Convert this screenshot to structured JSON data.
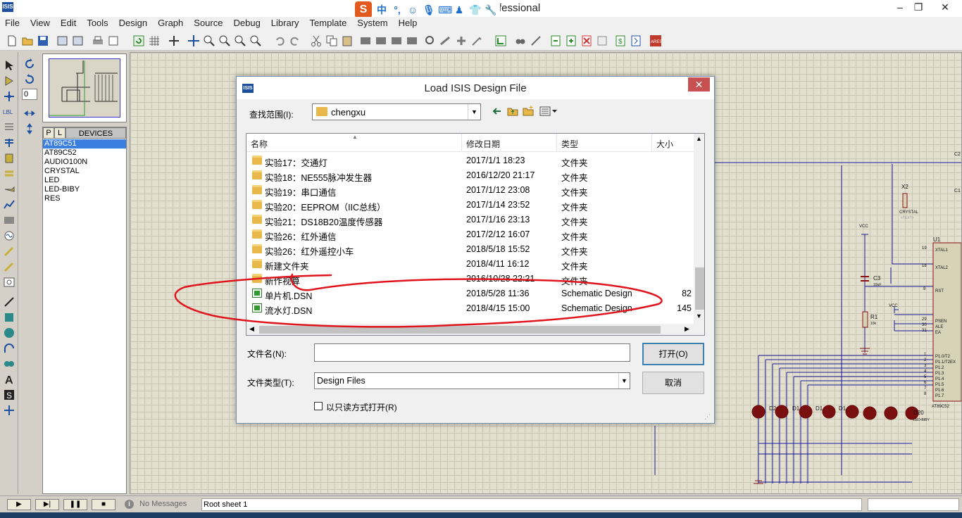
{
  "app": {
    "logo_text": "ISIS",
    "title": "fessional",
    "window_controls": {
      "minimize": "–",
      "maximize": "❐",
      "close": "✕"
    }
  },
  "ime": {
    "logo": "S",
    "items": [
      "中",
      "°,",
      "☺",
      "🎙",
      "⌨",
      "♟",
      "👕",
      "🔧"
    ]
  },
  "menu": [
    "File",
    "View",
    "Edit",
    "Tools",
    "Design",
    "Graph",
    "Source",
    "Debug",
    "Library",
    "Template",
    "System",
    "Help"
  ],
  "devices": {
    "tabs": [
      "P",
      "L"
    ],
    "title": "DEVICES",
    "items": [
      "AT89C51",
      "AT89C52",
      "AUDIO100N",
      "CRYSTAL",
      "LED",
      "LED-BIBY",
      "RES"
    ],
    "selected": "AT89C51"
  },
  "rotation": {
    "value": "0"
  },
  "statusbar": {
    "sim_buttons": [
      "▶",
      "▶|",
      "❚❚",
      "■"
    ],
    "message_icon": "i",
    "messages": "No Messages",
    "sheet": "Root sheet 1"
  },
  "dialog": {
    "logo_text": "ISIS",
    "title": "Load ISIS Design File",
    "close": "✕",
    "look_in_label": "查找范围(I):",
    "look_in_value": "chengxu",
    "columns": [
      "名称",
      "修改日期",
      "类型",
      "大小"
    ],
    "files": [
      {
        "name": "实验17：交通灯",
        "date": "2017/1/1 18:23",
        "type": "文件夹",
        "size": "",
        "kind": "folder"
      },
      {
        "name": "实验18：NE555脉冲发生器",
        "date": "2016/12/20 21:17",
        "type": "文件夹",
        "size": "",
        "kind": "folder"
      },
      {
        "name": "实验19：串口通信",
        "date": "2017/1/12 23:08",
        "type": "文件夹",
        "size": "",
        "kind": "folder"
      },
      {
        "name": "实验20：EEPROM（IIC总线）",
        "date": "2017/1/14 23:52",
        "type": "文件夹",
        "size": "",
        "kind": "folder"
      },
      {
        "name": "实验21：DS18B20温度传感器",
        "date": "2017/1/16 23:13",
        "type": "文件夹",
        "size": "",
        "kind": "folder"
      },
      {
        "name": "实验26：红外通信",
        "date": "2017/2/12 16:07",
        "type": "文件夹",
        "size": "",
        "kind": "folder"
      },
      {
        "name": "实验26：红外遥控小车",
        "date": "2018/5/18 15:52",
        "type": "文件夹",
        "size": "",
        "kind": "folder"
      },
      {
        "name": "新建文件夹",
        "date": "2018/4/11 16:12",
        "type": "文件夹",
        "size": "",
        "kind": "folder"
      },
      {
        "name": "新作视算",
        "date": "2016/10/28 22:21",
        "type": "文件夹",
        "size": "",
        "kind": "folder"
      },
      {
        "name": "单片机.DSN",
        "date": "2018/5/28 11:36",
        "type": "Schematic Design",
        "size": "82",
        "kind": "dsn"
      },
      {
        "name": "流水灯.DSN",
        "date": "2018/4/15 15:00",
        "type": "Schematic Design",
        "size": "145",
        "kind": "dsn"
      }
    ],
    "filename_label": "文件名(N):",
    "filename_value": "",
    "filetype_label": "文件类型(T):",
    "filetype_value": "Design Files",
    "open_label": "打开(O)",
    "cancel_label": "取消",
    "readonly_label": "以只读方式打开(R)"
  },
  "schematic": {
    "labels": [
      "C2",
      "C1",
      "X2",
      "CRYSTAL",
      "<TEXT>",
      "VCC",
      "U1",
      "XTAL1",
      "XTAL2",
      "RST",
      "C3",
      "10uF",
      "R1",
      "10k",
      "VCC",
      "PSEN",
      "ALE",
      "EA",
      "P1.0/T2",
      "P1.1/T2EX",
      "P1.2",
      "P1.3",
      "P1.4",
      "P1.5",
      "P1.6",
      "P1.7",
      "AT89C52",
      "D20",
      "LED-BIBY",
      "D2",
      "D1",
      "D1",
      "D1",
      "19",
      "18",
      "9",
      "29",
      "30",
      "31",
      "1",
      "2",
      "3",
      "4",
      "5",
      "6",
      "7",
      "8"
    ]
  },
  "colors": {
    "annotation": "#e0141c",
    "selection": "#3b7fe0",
    "close_button": "#c75050",
    "wire": "#1b1b9a"
  }
}
